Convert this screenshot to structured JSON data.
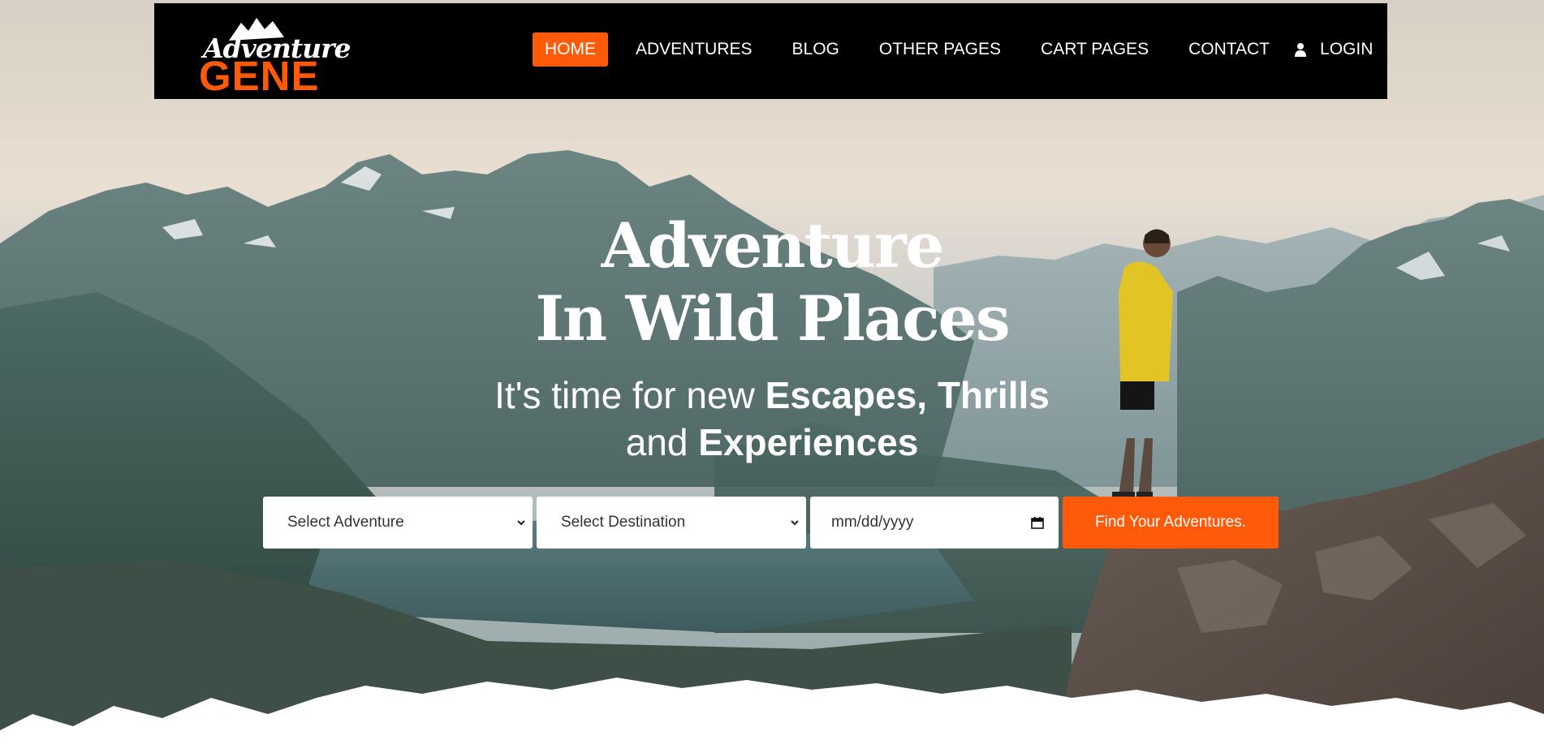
{
  "brand": {
    "logo_top": "Adventure",
    "logo_bottom": "GENE",
    "accent_color": "#ff5a0a"
  },
  "nav": {
    "items": [
      {
        "label": "HOME",
        "active": true
      },
      {
        "label": "ADVENTURES",
        "active": false
      },
      {
        "label": "BLOG",
        "active": false
      },
      {
        "label": "OTHER PAGES",
        "active": false
      },
      {
        "label": "CART PAGES",
        "active": false
      },
      {
        "label": "CONTACT",
        "active": false
      }
    ],
    "login": {
      "label": "LOGIN",
      "icon": "user-icon"
    }
  },
  "hero": {
    "title_line1": "Adventure",
    "title_line2": "In Wild Places",
    "subtitle_part1": "It's time for new ",
    "subtitle_bold1": "Escapes, Thrills",
    "subtitle_part2": "and ",
    "subtitle_bold2": "Experiences"
  },
  "search": {
    "adventure_select": {
      "value": "Select Adventure"
    },
    "destination_select": {
      "value": "Select Destination"
    },
    "date": {
      "placeholder": "mm/dd/yyyy"
    },
    "submit_label": "Find Your Adventures."
  }
}
